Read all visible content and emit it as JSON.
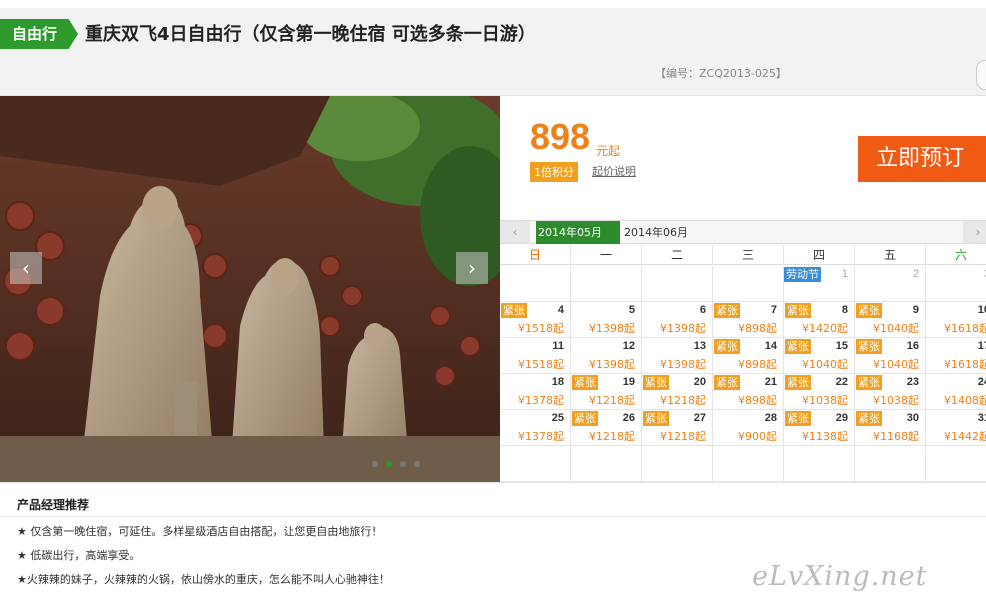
{
  "header": {
    "tag": "自由行",
    "title": "重庆双飞4日自由行（仅含第一晚住宿 可选多条一日游）",
    "code": "【编号：ZCQ2013-025】"
  },
  "gallery": {
    "prev": "‹",
    "next": "›",
    "dots": 4,
    "active_dot": 1
  },
  "price": {
    "amount": "898",
    "unit": "元起",
    "points_badge": "1倍积分",
    "note_link": "起价说明",
    "book_button": "立即预订"
  },
  "calendar": {
    "prev": "‹",
    "next": "›",
    "months": [
      "2014年05月",
      "2014年06月"
    ],
    "active_month": 0,
    "weekdays": [
      "日",
      "一",
      "二",
      "三",
      "四",
      "五",
      "六"
    ],
    "days": [
      {
        "day": "",
        "price": "",
        "tag": ""
      },
      {
        "day": "",
        "price": "",
        "tag": ""
      },
      {
        "day": "",
        "price": "",
        "tag": ""
      },
      {
        "day": "",
        "price": "",
        "tag": ""
      },
      {
        "day": "1",
        "price": "",
        "tag": "劳动节",
        "grey": true
      },
      {
        "day": "2",
        "price": "",
        "tag": "",
        "grey": true
      },
      {
        "day": "3",
        "price": "",
        "tag": "",
        "grey": true
      },
      {
        "day": "4",
        "price": "¥1518起",
        "tag": "紧张"
      },
      {
        "day": "5",
        "price": "¥1398起",
        "tag": ""
      },
      {
        "day": "6",
        "price": "¥1398起",
        "tag": ""
      },
      {
        "day": "7",
        "price": "¥898起",
        "tag": "紧张"
      },
      {
        "day": "8",
        "price": "¥1420起",
        "tag": "紧张"
      },
      {
        "day": "9",
        "price": "¥1040起",
        "tag": "紧张"
      },
      {
        "day": "10",
        "price": "¥1618起",
        "tag": ""
      },
      {
        "day": "11",
        "price": "¥1518起",
        "tag": ""
      },
      {
        "day": "12",
        "price": "¥1398起",
        "tag": ""
      },
      {
        "day": "13",
        "price": "¥1398起",
        "tag": ""
      },
      {
        "day": "14",
        "price": "¥898起",
        "tag": "紧张"
      },
      {
        "day": "15",
        "price": "¥1040起",
        "tag": "紧张"
      },
      {
        "day": "16",
        "price": "¥1040起",
        "tag": "紧张"
      },
      {
        "day": "17",
        "price": "¥1618起",
        "tag": ""
      },
      {
        "day": "18",
        "price": "¥1378起",
        "tag": ""
      },
      {
        "day": "19",
        "price": "¥1218起",
        "tag": "紧张"
      },
      {
        "day": "20",
        "price": "¥1218起",
        "tag": "紧张"
      },
      {
        "day": "21",
        "price": "¥898起",
        "tag": "紧张"
      },
      {
        "day": "22",
        "price": "¥1038起",
        "tag": "紧张"
      },
      {
        "day": "23",
        "price": "¥1038起",
        "tag": "紧张"
      },
      {
        "day": "24",
        "price": "¥1408起",
        "tag": ""
      },
      {
        "day": "25",
        "price": "¥1378起",
        "tag": ""
      },
      {
        "day": "26",
        "price": "¥1218起",
        "tag": "紧张"
      },
      {
        "day": "27",
        "price": "¥1218起",
        "tag": "紧张"
      },
      {
        "day": "28",
        "price": "¥900起",
        "tag": ""
      },
      {
        "day": "29",
        "price": "¥1138起",
        "tag": "紧张"
      },
      {
        "day": "30",
        "price": "¥1168起",
        "tag": "紧张"
      },
      {
        "day": "31",
        "price": "¥1442起",
        "tag": ""
      },
      {
        "day": "",
        "price": "",
        "tag": ""
      },
      {
        "day": "",
        "price": "",
        "tag": ""
      },
      {
        "day": "",
        "price": "",
        "tag": ""
      },
      {
        "day": "",
        "price": "",
        "tag": ""
      },
      {
        "day": "",
        "price": "",
        "tag": ""
      },
      {
        "day": "",
        "price": "",
        "tag": ""
      },
      {
        "day": "",
        "price": "",
        "tag": ""
      }
    ]
  },
  "recommend": {
    "title": "产品经理推荐",
    "lines": [
      "★ 仅含第一晚住宿，可延住。多样星级酒店自由搭配，让您更自由地旅行！",
      "★ 低碳出行，高端享受。",
      "★火辣辣的妹子，火辣辣的火锅，依山傍水的重庆，怎么能不叫人心驰神往！"
    ],
    "watermark": "eLvXing.net"
  },
  "colors": {
    "green": "#2e9a2e",
    "orange": "#f08119",
    "book": "#f05a14",
    "holiday": "#3b8fd6"
  }
}
